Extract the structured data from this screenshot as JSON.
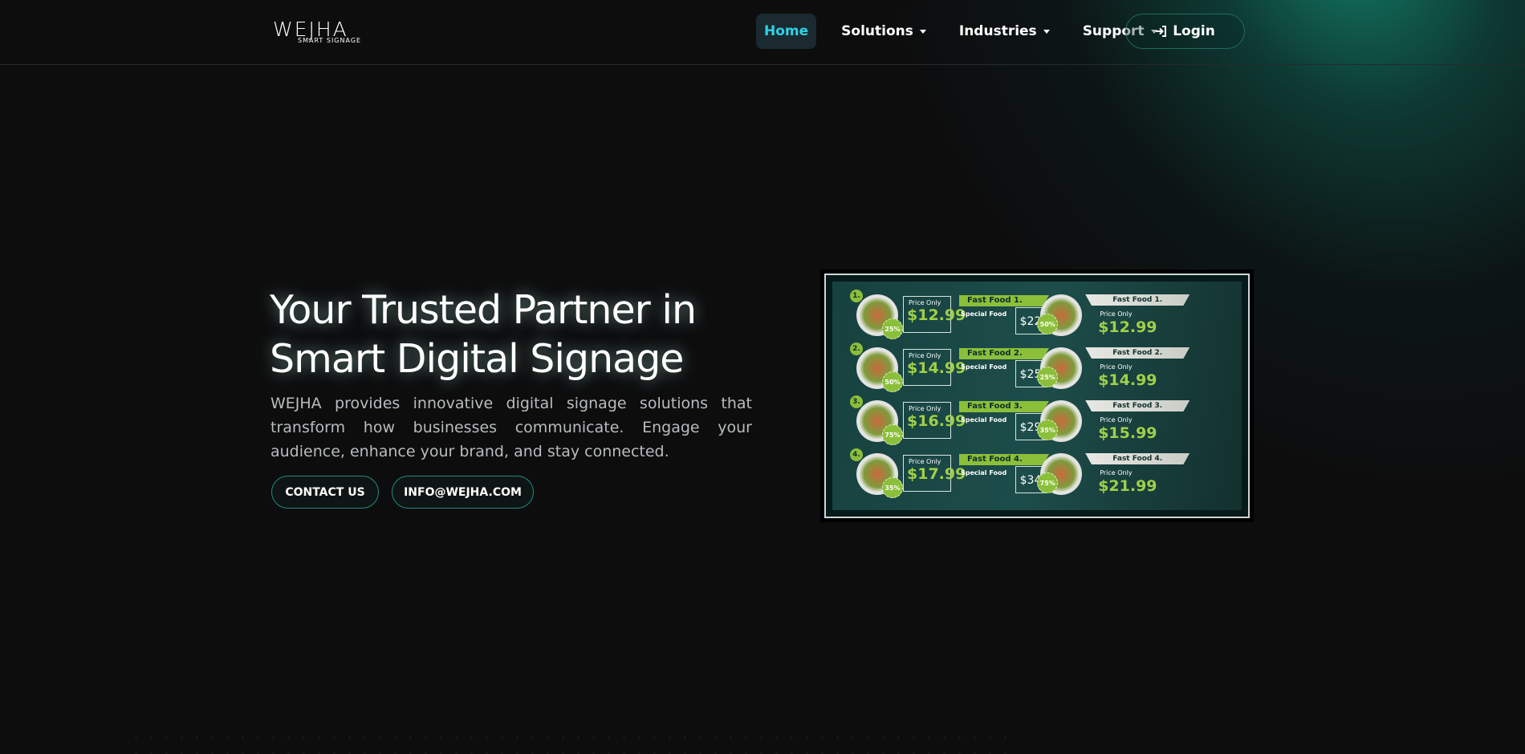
{
  "brand": {
    "name": "WEJHA",
    "tagline": "SMART SIGNAGE"
  },
  "nav": {
    "items": [
      {
        "label": "Home",
        "dropdown": false,
        "active": true
      },
      {
        "label": "Solutions",
        "dropdown": true,
        "active": false
      },
      {
        "label": "Industries",
        "dropdown": true,
        "active": false
      },
      {
        "label": "Support",
        "dropdown": true,
        "active": false
      }
    ],
    "login_label": "Login",
    "login_icon": "sign-in-icon"
  },
  "hero": {
    "title_line1": "Your Trusted Partner in",
    "title_line2": "Smart Digital Signage",
    "description": "WEJHA provides innovative digital signage solutions that transform how businesses communicate. Engage your audience, enhance your brand, and stay connected.",
    "contact_button": "CONTACT US",
    "email_button": "INFO@WEJHA.COM"
  },
  "signage_display": {
    "left_column": [
      {
        "number": "1.",
        "price_label": "Price Only",
        "price": "$12.99",
        "badge": "25%",
        "tag": "Fast Food 1.",
        "item": "Special Food",
        "item_price": "$22"
      },
      {
        "number": "2.",
        "price_label": "Price Only",
        "price": "$14.99",
        "badge": "50%",
        "tag": "Fast Food 2.",
        "item": "Special Food",
        "item_price": "$25"
      },
      {
        "number": "3.",
        "price_label": "Price Only",
        "price": "$16.99",
        "badge": "75%",
        "tag": "Fast Food 3.",
        "item": "Special Food",
        "item_price": "$29"
      },
      {
        "number": "4.",
        "price_label": "Price Only",
        "price": "$17.99",
        "badge": "35%",
        "tag": "Fast Food 4.",
        "item": "Special Food",
        "item_price": "$34"
      }
    ],
    "right_column": [
      {
        "tag": "Fast Food 1.",
        "price_label": "Price Only",
        "price": "$12.99",
        "badge": "50%"
      },
      {
        "tag": "Fast Food 2.",
        "price_label": "Price Only",
        "price": "$14.99",
        "badge": "25%"
      },
      {
        "tag": "Fast Food 3.",
        "price_label": "Price Only",
        "price": "$15.99",
        "badge": "35%"
      },
      {
        "tag": "Fast Food 4.",
        "price_label": "Price Only",
        "price": "$21.99",
        "badge": "75%"
      }
    ]
  },
  "colors": {
    "background": "#0d0d0e",
    "accent": "#2ed3e6",
    "button_border": "#1f8a7c",
    "glow": "#14a082",
    "menu_green": "#8bbf3a"
  }
}
